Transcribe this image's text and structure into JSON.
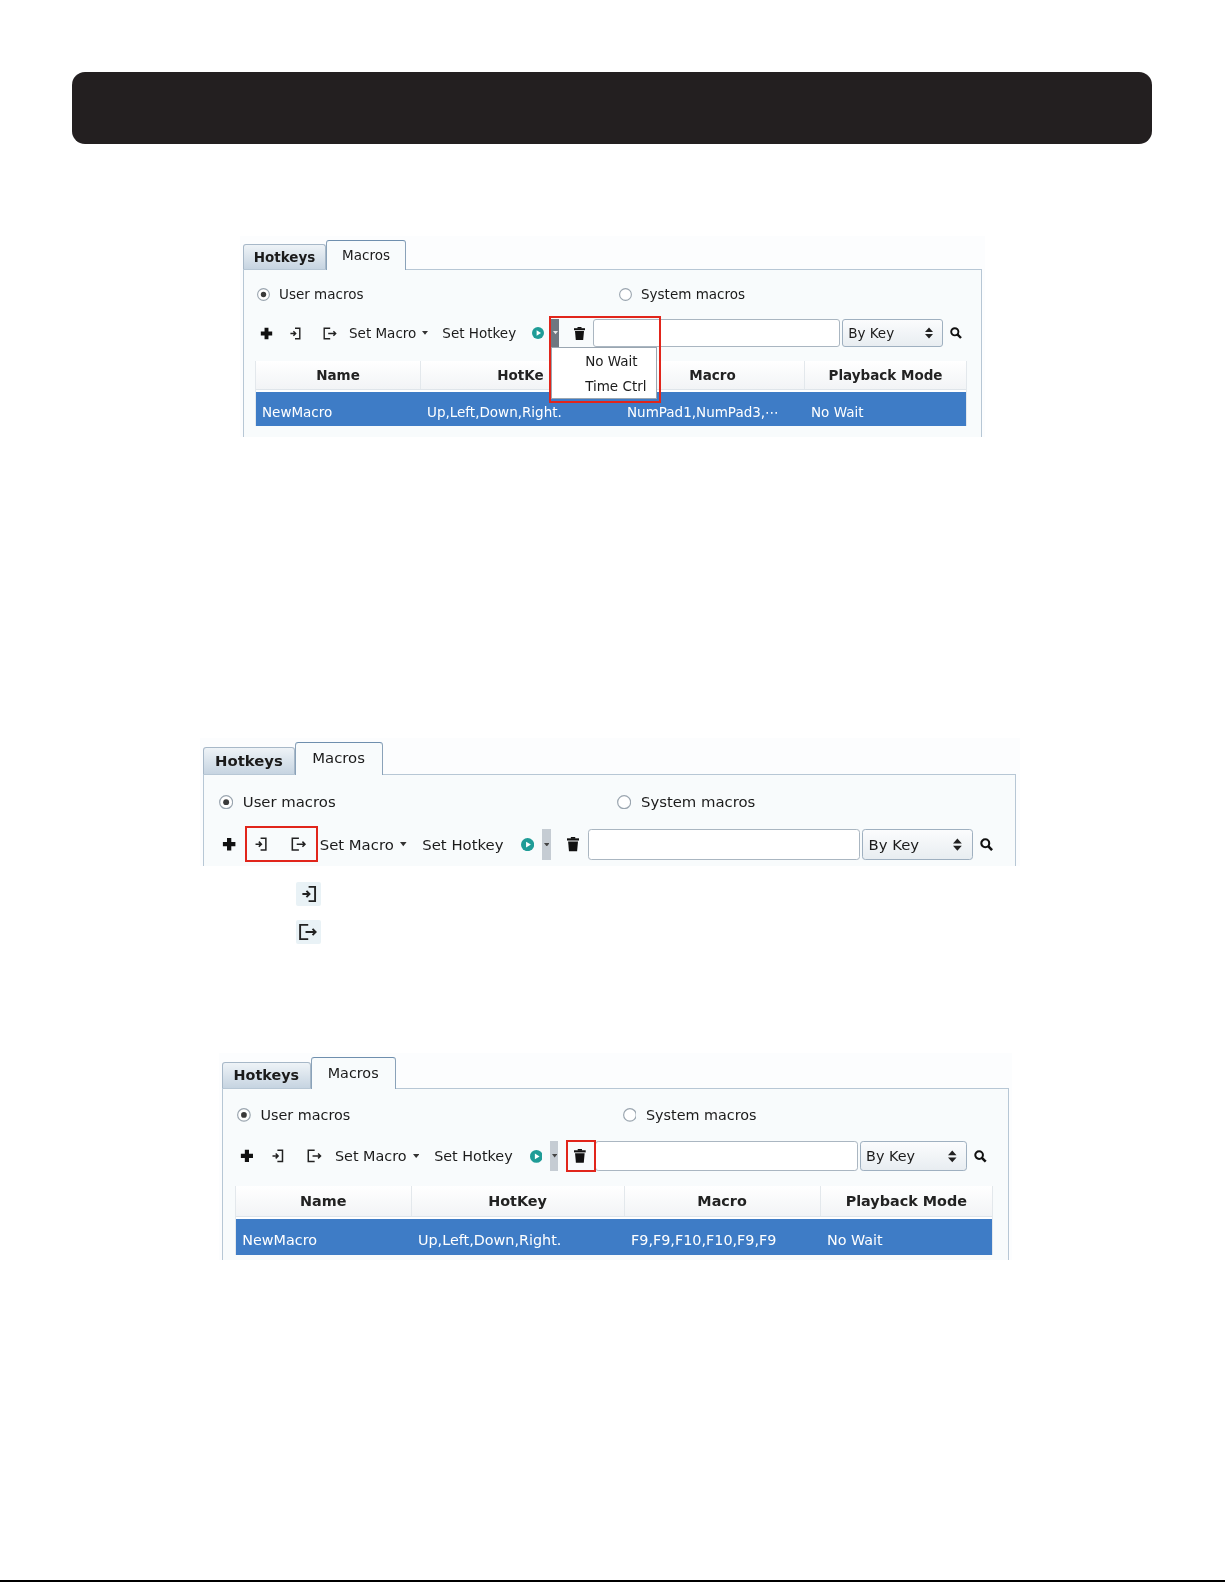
{
  "screenshots": [
    {
      "tabs": [
        {
          "label": "Hotkeys",
          "selected": false
        },
        {
          "label": "Macros",
          "selected": true
        }
      ],
      "radios": [
        {
          "label": "User macros",
          "selected": true
        },
        {
          "label": "System macros",
          "selected": false
        }
      ],
      "toolbar": [
        {
          "kind": "add"
        },
        {
          "kind": "import"
        },
        {
          "kind": "export"
        },
        {
          "kind": "menu",
          "label": "Set Macro"
        },
        {
          "kind": "button",
          "label": "Set Hotkey"
        },
        {
          "kind": "play",
          "open": true,
          "menu": [
            "No Wait",
            "Time Ctrl"
          ]
        },
        {
          "kind": "delete"
        },
        {
          "kind": "field"
        },
        {
          "kind": "select",
          "value": "By Key"
        },
        {
          "kind": "search"
        }
      ],
      "table": {
        "columns": [
          "Name",
          "HotKe",
          "Macro",
          "Playback Mode"
        ],
        "rows": [
          {
            "selected": true,
            "cells": [
              "NewMacro",
              "Up,Left,Down,Right.",
              "NumPad1,NumPad3,⋯",
              "No Wait"
            ]
          }
        ]
      },
      "highlight": {
        "kind": "playback-menu"
      }
    },
    {
      "tabs": [
        {
          "label": "Hotkeys",
          "selected": false
        },
        {
          "label": "Macros",
          "selected": true
        }
      ],
      "radios": [
        {
          "label": "User macros",
          "selected": true
        },
        {
          "label": "System macros",
          "selected": false
        }
      ],
      "toolbar": [
        {
          "kind": "add"
        },
        {
          "kind": "import"
        },
        {
          "kind": "export"
        },
        {
          "kind": "menu",
          "label": "Set Macro"
        },
        {
          "kind": "button",
          "label": "Set Hotkey"
        },
        {
          "kind": "play",
          "open": false
        },
        {
          "kind": "delete"
        },
        {
          "kind": "field"
        },
        {
          "kind": "select",
          "value": "By Key"
        },
        {
          "kind": "search"
        }
      ],
      "highlight": {
        "kind": "import-export"
      },
      "icon_legend": [
        {
          "kind": "import"
        },
        {
          "kind": "export"
        }
      ]
    },
    {
      "tabs": [
        {
          "label": "Hotkeys",
          "selected": false
        },
        {
          "label": "Macros",
          "selected": true
        }
      ],
      "radios": [
        {
          "label": "User macros",
          "selected": true
        },
        {
          "label": "System macros",
          "selected": false
        }
      ],
      "toolbar": [
        {
          "kind": "add"
        },
        {
          "kind": "import"
        },
        {
          "kind": "export"
        },
        {
          "kind": "menu",
          "label": "Set Macro"
        },
        {
          "kind": "button",
          "label": "Set Hotkey"
        },
        {
          "kind": "play",
          "open": false
        },
        {
          "kind": "delete"
        },
        {
          "kind": "field"
        },
        {
          "kind": "select",
          "value": "By Key"
        },
        {
          "kind": "search"
        }
      ],
      "table": {
        "columns": [
          "Name",
          "HotKey",
          "Macro",
          "Playback Mode"
        ],
        "rows": [
          {
            "selected": true,
            "cells": [
              "NewMacro",
              "Up,Left,Down,Right.",
              "F9,F9,F10,F10,F9,F9",
              "No Wait"
            ]
          }
        ]
      },
      "highlight": {
        "kind": "delete"
      }
    }
  ]
}
